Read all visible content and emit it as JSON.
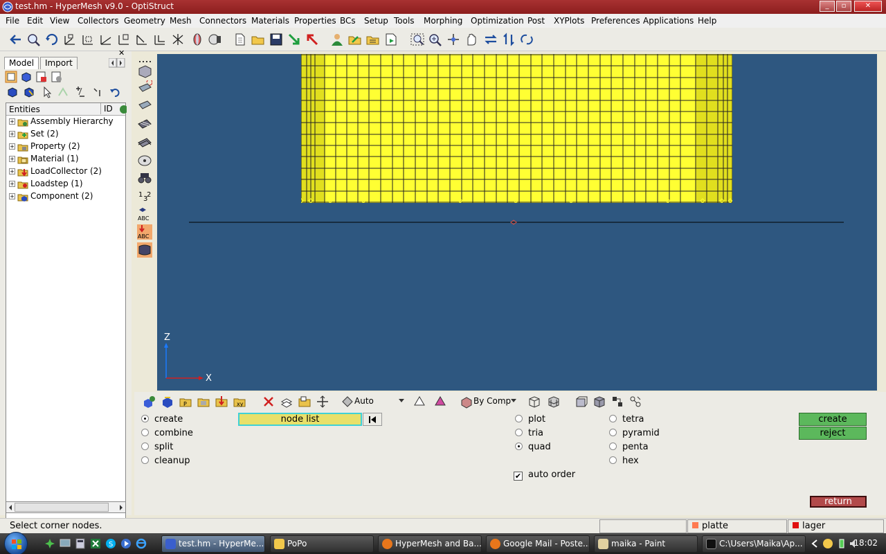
{
  "window": {
    "title": "test.hm - HyperMesh v9.0 - OptiStruct",
    "minimize": "_",
    "maximize": "▫",
    "close": "✕"
  },
  "menu": [
    "File",
    "Edit",
    "View",
    "Collectors",
    "Geometry",
    "Mesh",
    "Connectors",
    "Materials",
    "Properties",
    "BCs",
    "Setup",
    "Tools",
    "Morphing",
    "Optimization",
    "Post",
    "XYPlots",
    "Preferences",
    "Applications",
    "Help"
  ],
  "browser": {
    "tabs": [
      "Model",
      "Import"
    ],
    "columns": [
      "Entities",
      "ID"
    ],
    "items": [
      {
        "label": "Assembly Hierarchy",
        "icon": "assembly-icon"
      },
      {
        "label": "Set (2)",
        "icon": "set-icon"
      },
      {
        "label": "Property (2)",
        "icon": "property-icon"
      },
      {
        "label": "Material (1)",
        "icon": "material-icon"
      },
      {
        "label": "LoadCollector (2)",
        "icon": "loadcollector-icon"
      },
      {
        "label": "Loadstep (1)",
        "icon": "loadstep-icon"
      },
      {
        "label": "Component (2)",
        "icon": "component-icon"
      }
    ],
    "close": "✕"
  },
  "viewport": {
    "axis_z": "Z",
    "axis_x": "X",
    "background": "#2e5780",
    "mesh_color": "#ffff33"
  },
  "panelbar": {
    "display_mode": "Auto",
    "color_mode": "By Comp"
  },
  "panel": {
    "modes": [
      {
        "label": "create",
        "selected": true
      },
      {
        "label": "combine",
        "selected": false
      },
      {
        "label": "split",
        "selected": false
      },
      {
        "label": "cleanup",
        "selected": false
      }
    ],
    "selector": "node list",
    "element_types_left": [
      {
        "label": "plot",
        "selected": false
      },
      {
        "label": "tria",
        "selected": false
      },
      {
        "label": "quad",
        "selected": true
      }
    ],
    "element_types_right": [
      {
        "label": "tetra",
        "selected": false
      },
      {
        "label": "pyramid",
        "selected": false
      },
      {
        "label": "penta",
        "selected": false
      },
      {
        "label": "hex",
        "selected": false
      }
    ],
    "auto_order_label": "auto order",
    "auto_order_checked": "✔",
    "create_label": "create",
    "reject_label": "reject",
    "return_label": "return"
  },
  "status": {
    "message": "Select corner nodes.",
    "component_1": "platte",
    "component_1_color": "#ff7a50",
    "component_2": "lager",
    "component_2_color": "#e01010"
  },
  "taskbar": {
    "tasks": [
      {
        "label": "test.hm - HyperMe...",
        "active": true
      },
      {
        "label": "PoPo",
        "active": false
      },
      {
        "label": "HyperMesh and Ba...",
        "active": false
      },
      {
        "label": "Google Mail - Poste...",
        "active": false
      },
      {
        "label": "maika - Paint",
        "active": false
      },
      {
        "label": "C:\\Users\\Maika\\Ap...",
        "active": false
      }
    ],
    "clock": "18:02"
  }
}
